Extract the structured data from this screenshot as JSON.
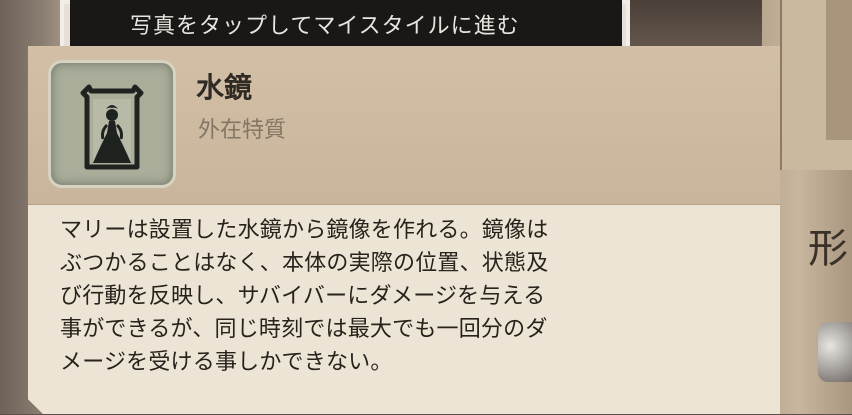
{
  "banner": {
    "text": "写真をタップしてマイスタイルに進む"
  },
  "side": {
    "glyph": "形"
  },
  "trait": {
    "name": "水鏡",
    "category": "外在特質",
    "icon": "mirror-lady-icon",
    "description_lines": [
      "マリーは設置した水鏡から鏡像を作れる。鏡像は",
      "ぶつかることはなく、本体の実際の位置、状態及",
      "び行動を反映し、サバイバーにダメージを与える",
      "事ができるが、同じ時刻では最大でも一回分のダ",
      "メージを受ける事しかできない。"
    ]
  },
  "colors": {
    "card_header": "#cbb79d",
    "card_body": "#ece4d4",
    "icon_bg": "#a9ad9a",
    "title_text": "#2f2a24",
    "subtitle_text": "#837664"
  }
}
